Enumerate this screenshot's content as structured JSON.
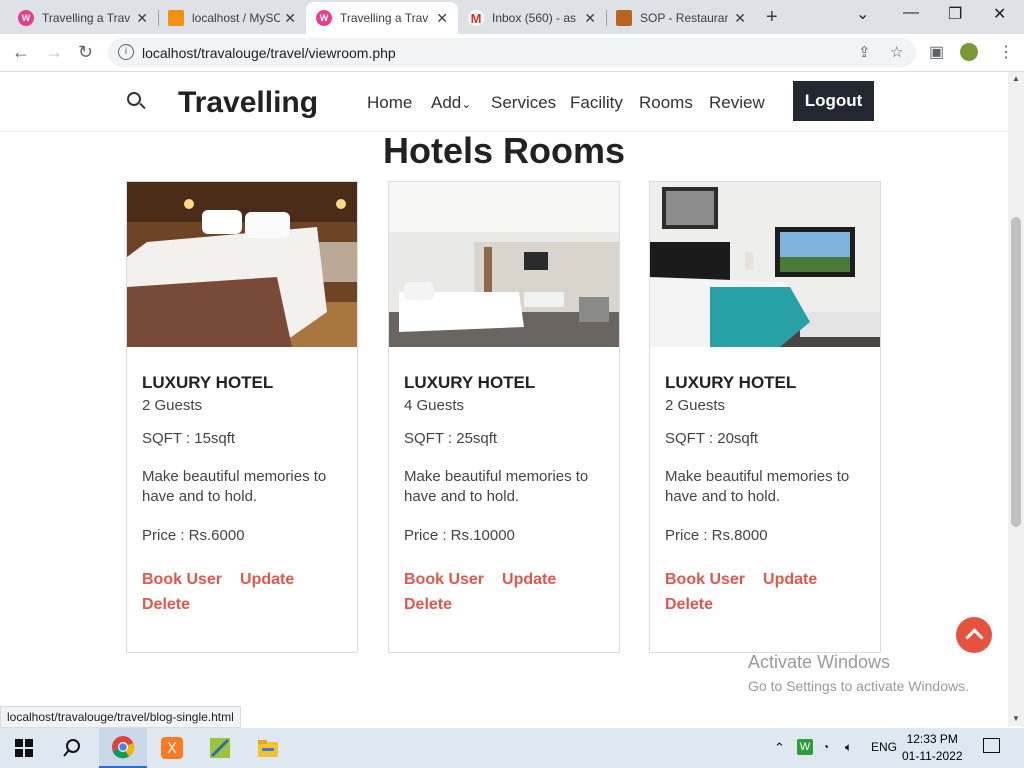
{
  "browser": {
    "tabs": [
      {
        "title": "Travelling a Trav",
        "icon": "travel-site-favicon",
        "color": "#e83e8c"
      },
      {
        "title": "localhost / MySC",
        "icon": "phpmyadmin-favicon",
        "color": "#f29111"
      },
      {
        "title": "Travelling a Trav",
        "icon": "travel-site-favicon",
        "color": "#e83e8c"
      },
      {
        "title": "Inbox (560) - as",
        "icon": "gmail-favicon",
        "color": "#d93025"
      },
      {
        "title": "SOP - Restaurant",
        "icon": "restaurant-favicon",
        "color": "#b5651d"
      }
    ],
    "url": "localhost/travalouge/travel/viewroom.php",
    "status_url": "localhost/travalouge/travel/blog-single.html"
  },
  "site": {
    "brand": "Travelling",
    "menu": [
      "Home",
      "Add",
      "Services",
      "Facility",
      "Rooms",
      "Review"
    ],
    "logout": "Logout",
    "heading": "Hotels Rooms"
  },
  "rooms": [
    {
      "name": "LUXURY HOTEL",
      "guests": "2 Guests",
      "sqft": "SQFT : 15sqft",
      "desc": "Make beautiful memories to have and to hold.",
      "price": "Price : Rs.6000",
      "book": "Book User",
      "update": "Update",
      "delete": "Delete"
    },
    {
      "name": "LUXURY HOTEL",
      "guests": "4 Guests",
      "sqft": "SQFT : 25sqft",
      "desc": "Make beautiful memories to have and to hold.",
      "price": "Price : Rs.10000",
      "book": "Book User",
      "update": "Update",
      "delete": "Delete"
    },
    {
      "name": "LUXURY HOTEL",
      "guests": "2 Guests",
      "sqft": "SQFT : 20sqft",
      "desc": "Make beautiful memories to have and to hold.",
      "price": "Price : Rs.8000",
      "book": "Book User",
      "update": "Update",
      "delete": "Delete"
    }
  ],
  "watermark": {
    "line1": "Activate Windows",
    "line2": "Go to Settings to activate Windows."
  },
  "taskbar": {
    "lang": "ENG",
    "time": "12:33 PM",
    "date": "01-11-2022"
  },
  "colors": {
    "accent": "#e0584b",
    "logout_bg": "#222831",
    "totop": "#e5533f"
  }
}
